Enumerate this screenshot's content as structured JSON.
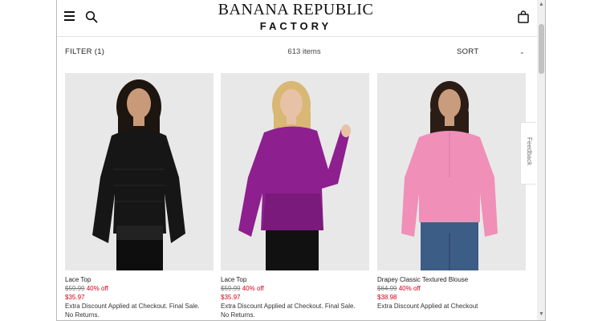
{
  "header": {
    "logo_line1": "BANANA REPUBLIC",
    "logo_line2": "FACTORY",
    "menu_icon": "hamburger-icon",
    "search_icon": "search-icon",
    "bag_icon": "shopping-bag-icon"
  },
  "toolbar": {
    "filter_label": "FILTER (1)",
    "item_count": "613 items",
    "sort_label": "SORT",
    "sort_icon": "chevron-down-icon"
  },
  "products": [
    {
      "name": "Lace Top",
      "original_price": "$59.99",
      "discount": "40% off",
      "sale_price": "$35.97",
      "note_line1": "Extra Discount Applied at Checkout. Final Sale.",
      "note_line2": "No Returns.",
      "top_color": "#151515",
      "bg_color": "#e8e8e8"
    },
    {
      "name": "Lace Top",
      "original_price": "$59.99",
      "discount": "40% off",
      "sale_price": "$35.97",
      "note_line1": "Extra Discount Applied at Checkout. Final Sale.",
      "note_line2": "No Returns.",
      "top_color": "#8d1f8f",
      "bg_color": "#e8e8e8"
    },
    {
      "name": "Drapey Classic Textured Blouse",
      "original_price": "$64.99",
      "discount": "40% off",
      "sale_price": "$38.98",
      "note_line1": "Extra Discount Applied at Checkout",
      "note_line2": "",
      "top_color": "#ef8fb6",
      "bg_color": "#e8e8e8"
    }
  ],
  "feedback_label": "Feedback",
  "colors": {
    "sale_red": "#d4001a",
    "text_dark": "#222222"
  }
}
